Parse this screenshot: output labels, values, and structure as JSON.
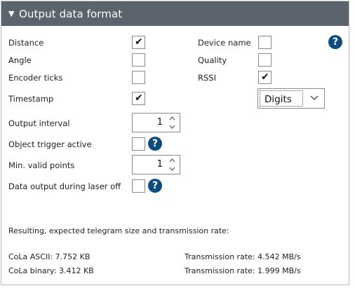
{
  "header": {
    "title": "Output data format"
  },
  "fields": {
    "distance": {
      "label": "Distance",
      "checked": true
    },
    "angle": {
      "label": "Angle",
      "checked": false
    },
    "encoder_ticks": {
      "label": "Encoder ticks",
      "checked": false
    },
    "timestamp": {
      "label": "Timestamp",
      "checked": true
    },
    "device_name": {
      "label": "Device name",
      "checked": false
    },
    "quality": {
      "label": "Quality",
      "checked": false
    },
    "rssi": {
      "label": "RSSI",
      "checked": true
    },
    "rssi_format": {
      "value": "Digits"
    },
    "output_interval": {
      "label": "Output interval",
      "value": "1"
    },
    "object_trigger": {
      "label": "Object trigger active",
      "checked": false
    },
    "min_valid_points": {
      "label": "Min. valid points",
      "value": "1"
    },
    "data_output_laser_off": {
      "label": "Data output during laser off",
      "checked": false
    }
  },
  "icons": {
    "checkmark": "✔",
    "help": "?"
  },
  "result": {
    "heading": "Resulting, expected telegram size and transmission rate:",
    "cola_ascii": "CoLa ASCII: 7.752 KB",
    "cola_binary": "CoLa binary: 3.412 KB",
    "rate_ascii": "Transmission rate: 4.542 MB/s",
    "rate_binary": "Transmission rate: 1.999 MB/s"
  },
  "colors": {
    "header_bg": "#5b636c",
    "help_icon": "#0e4c7d"
  }
}
